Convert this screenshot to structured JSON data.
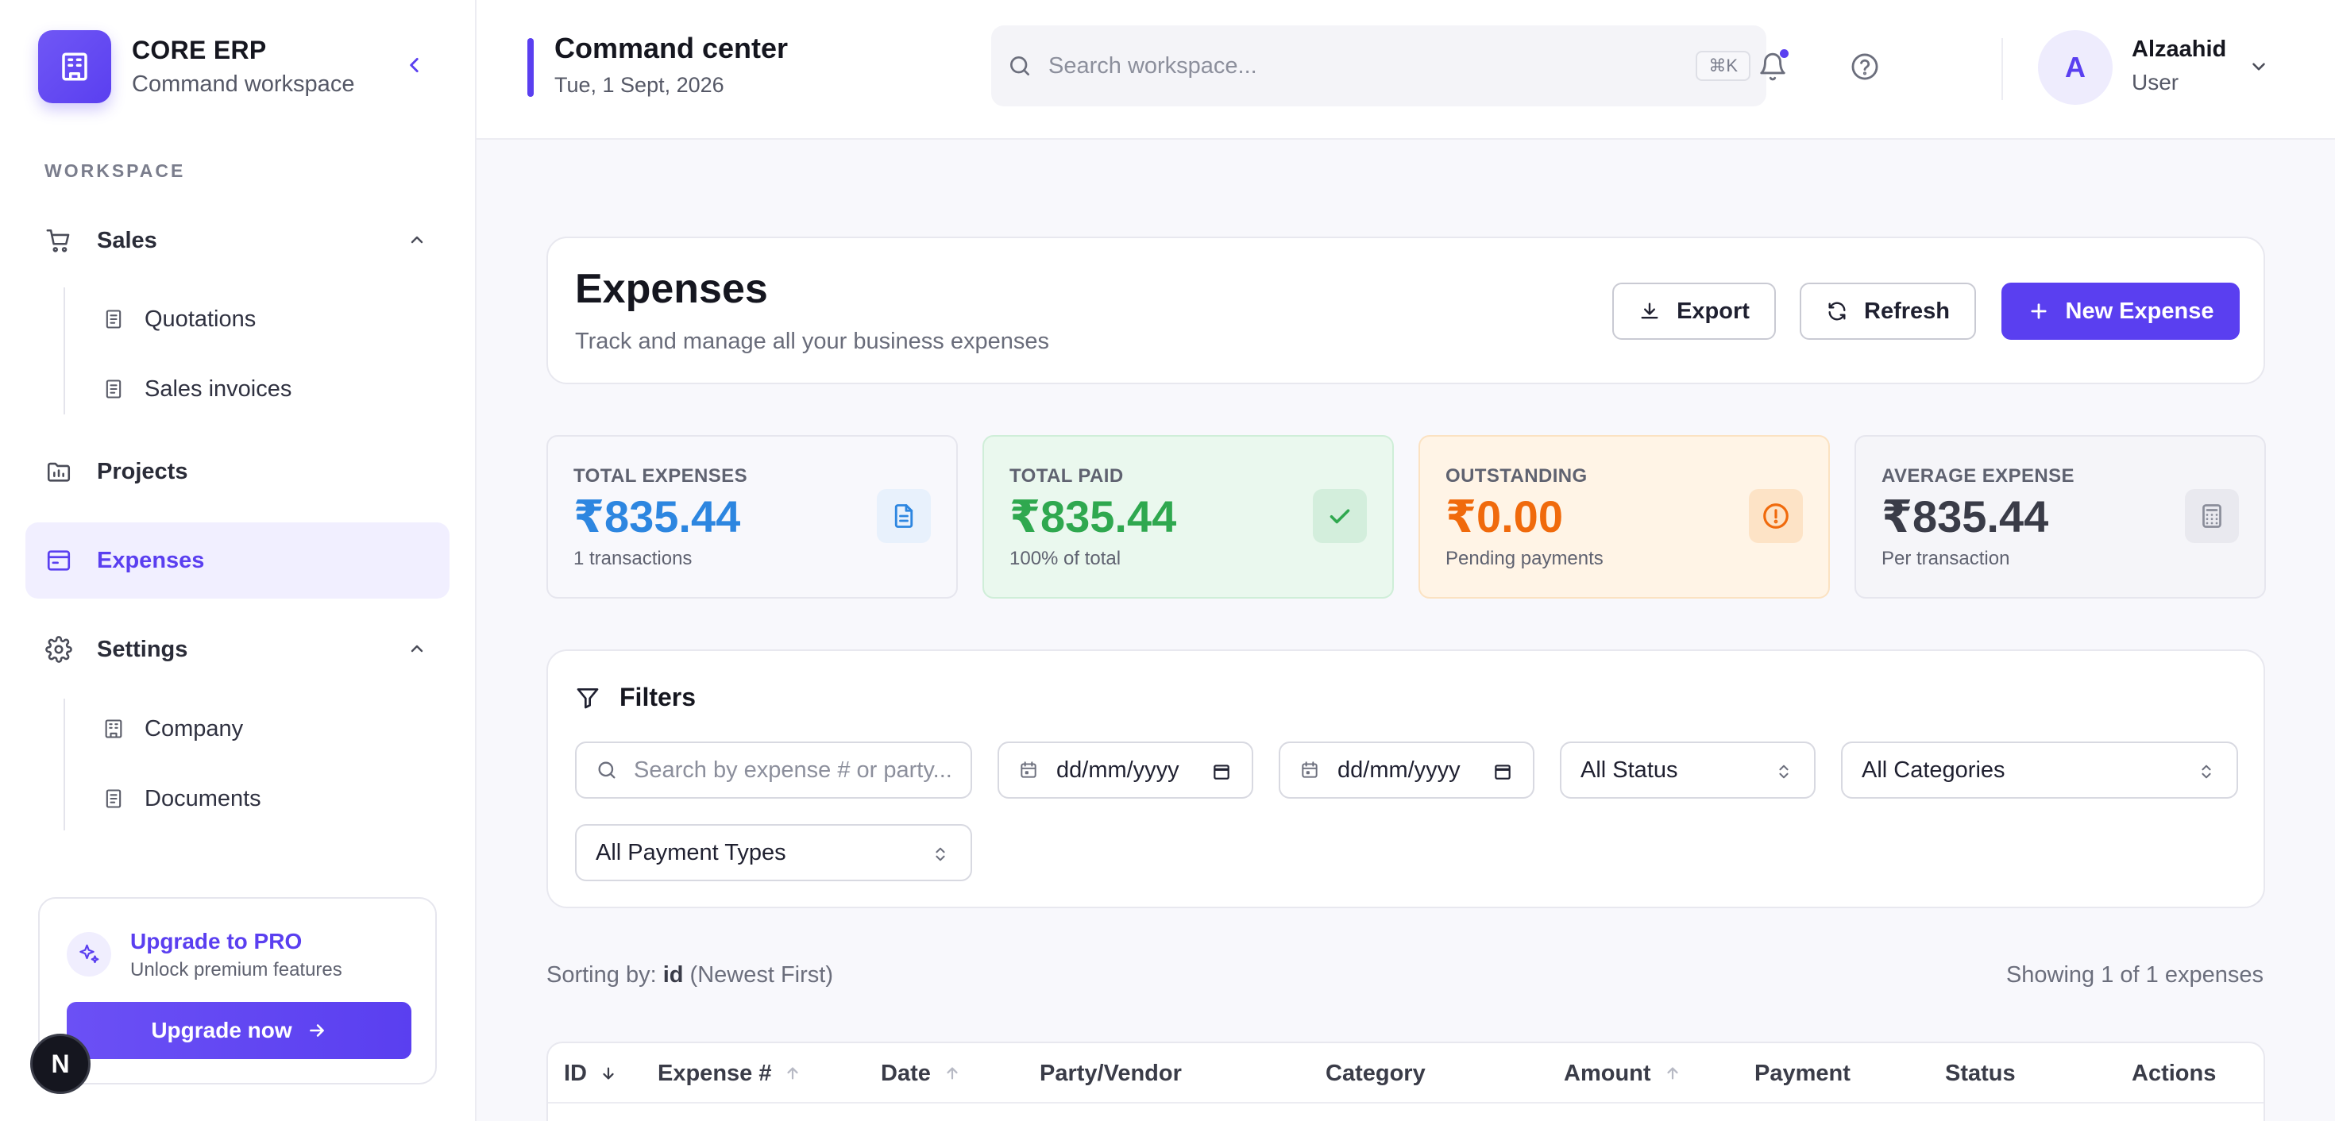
{
  "sidebar": {
    "brand_title": "CORE ERP",
    "brand_sub": "Command workspace",
    "section_label": "WORKSPACE",
    "sales": {
      "label": "Sales",
      "items": [
        {
          "label": "Quotations"
        },
        {
          "label": "Sales invoices"
        }
      ]
    },
    "projects": {
      "label": "Projects"
    },
    "expenses": {
      "label": "Expenses"
    },
    "settings": {
      "label": "Settings",
      "items": [
        {
          "label": "Company"
        },
        {
          "label": "Documents"
        }
      ]
    },
    "upgrade": {
      "title": "Upgrade to PRO",
      "sub": "Unlock premium features",
      "button": "Upgrade now"
    },
    "badge": "N"
  },
  "topbar": {
    "title": "Command center",
    "date": "Tue, 1 Sept, 2026",
    "search_placeholder": "Search workspace...",
    "search_shortcut": "⌘K",
    "user": {
      "initial": "A",
      "name": "Alzaahid",
      "role": "User"
    }
  },
  "header": {
    "title": "Expenses",
    "subtitle": "Track and manage all your business expenses",
    "export_label": "Export",
    "refresh_label": "Refresh",
    "new_label": "New Expense"
  },
  "stats": [
    {
      "label": "TOTAL EXPENSES",
      "value": "₹835.44",
      "sub": "1 transactions",
      "color": "#2d86e0",
      "bg": "#ffffff",
      "icon": "document-icon"
    },
    {
      "label": "TOTAL PAID",
      "value": "₹835.44",
      "sub": "100% of total",
      "color": "#2fa84f",
      "bg": "#eaf8ee",
      "icon": "check-icon"
    },
    {
      "label": "OUTSTANDING",
      "value": "₹0.00",
      "sub": "Pending payments",
      "color": "#f06a0c",
      "bg": "#fff4e6",
      "icon": "alert-circle-icon"
    },
    {
      "label": "AVERAGE EXPENSE",
      "value": "₹835.44",
      "sub": "Per transaction",
      "color": "#3a3c48",
      "bg": "#f5f5f9",
      "icon": "calculator-icon"
    }
  ],
  "filters": {
    "title": "Filters",
    "search_placeholder": "Search by expense # or party...",
    "date_from": "dd/mm/yyyy",
    "date_to": "dd/mm/yyyy",
    "status": "All Status",
    "category": "All Categories",
    "payment_type": "All Payment Types"
  },
  "list": {
    "sort_prefix": "Sorting by:",
    "sort_field": "id",
    "sort_dir": "(Newest First)",
    "showing": "Showing 1 of 1 expenses"
  },
  "table": {
    "columns": [
      "ID",
      "Expense #",
      "Date",
      "Party/Vendor",
      "Category",
      "Amount",
      "Payment",
      "Status",
      "Actions"
    ]
  },
  "colors": {
    "accent": "#5a3ff0"
  }
}
